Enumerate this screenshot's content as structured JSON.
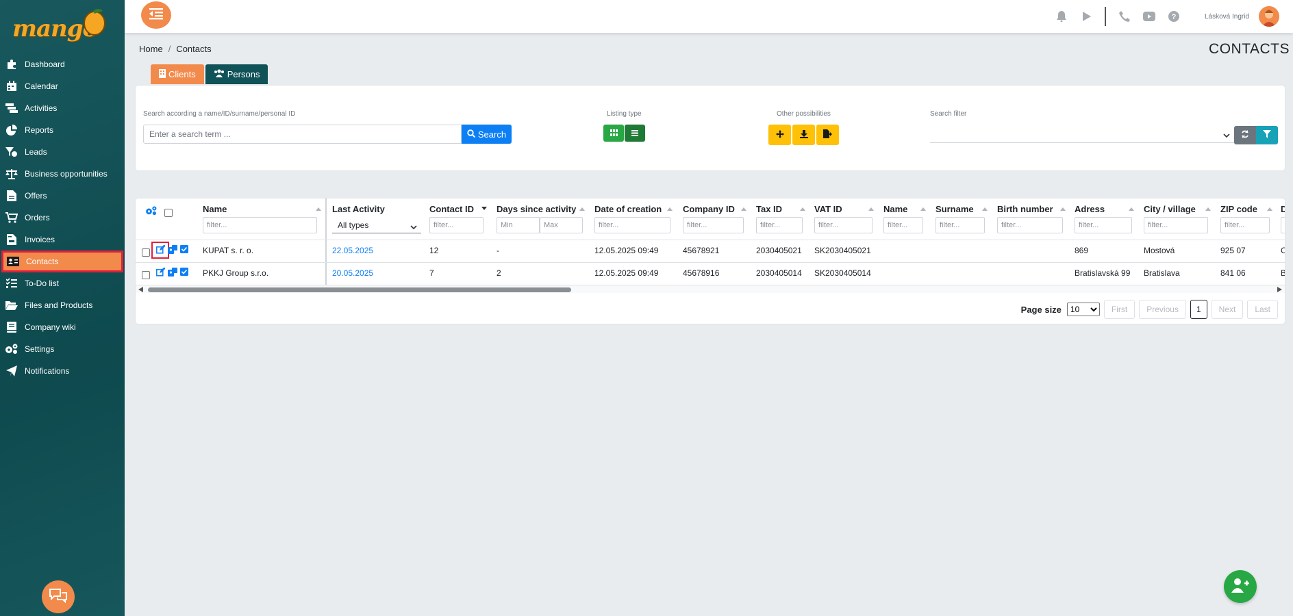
{
  "app": {
    "logo_text": "mango"
  },
  "sidebar": {
    "items": [
      {
        "label": "Dashboard",
        "icon": "puzzle-icon"
      },
      {
        "label": "Calendar",
        "icon": "calendar-icon"
      },
      {
        "label": "Activities",
        "icon": "activities-icon"
      },
      {
        "label": "Reports",
        "icon": "pie-chart-icon"
      },
      {
        "label": "Leads",
        "icon": "funnel-dollar-icon"
      },
      {
        "label": "Business opportunities",
        "icon": "scale-icon"
      },
      {
        "label": "Offers",
        "icon": "document-icon"
      },
      {
        "label": "Orders",
        "icon": "cart-icon"
      },
      {
        "label": "Invoices",
        "icon": "invoice-icon"
      },
      {
        "label": "Contacts",
        "icon": "address-card-icon",
        "active": true
      },
      {
        "label": "To-Do list",
        "icon": "checklist-icon"
      },
      {
        "label": "Files and Products",
        "icon": "folder-open-icon"
      },
      {
        "label": "Company wiki",
        "icon": "book-icon"
      },
      {
        "label": "Settings",
        "icon": "gears-icon"
      },
      {
        "label": "Notifications",
        "icon": "paper-plane-icon"
      }
    ]
  },
  "topbar": {
    "user_name": "Lásková Ingrid"
  },
  "breadcrumb": {
    "home": "Home",
    "sep": "/",
    "current": "Contacts"
  },
  "page_title": "CONTACTS",
  "tabs": {
    "clients": "Clients",
    "persons": "Persons"
  },
  "search": {
    "label": "Search according a name/ID/surname/personal ID",
    "placeholder": "Enter a search term ...",
    "button": "Search",
    "listing_label": "Listing type",
    "other_label": "Other possibilities",
    "filter_label": "Search filter"
  },
  "table": {
    "columns": {
      "name": "Name",
      "last_activity": "Last Activity",
      "contact_id": "Contact ID",
      "days_since": "Days since activity",
      "date_creation": "Date of creation",
      "company_id": "Company ID",
      "tax_id": "Tax ID",
      "vat_id": "VAT ID",
      "name2": "Name",
      "surname": "Surname",
      "birth": "Birth number",
      "adress": "Adress",
      "city": "City / village",
      "zip": "ZIP code",
      "next": "D"
    },
    "filter_placeholder": "filter...",
    "activity_select": "All types",
    "min_placeholder": "Min",
    "max_placeholder": "Max",
    "rows": [
      {
        "name": "KUPAT s. r. o.",
        "last_activity": "22.05.2025",
        "contact_id": "12",
        "days_since": "-",
        "date_creation": "12.05.2025 09:49",
        "company_id": "45678921",
        "tax_id": "2030405021",
        "vat_id": "SK2030405021",
        "adress": "869",
        "city": "Mostová",
        "zip": "925 07",
        "next": "C"
      },
      {
        "name": "PKKJ Group s.r.o.",
        "last_activity": "20.05.2025",
        "contact_id": "7",
        "days_since": "2",
        "date_creation": "12.05.2025 09:49",
        "company_id": "45678916",
        "tax_id": "2030405014",
        "vat_id": "SK2030405014",
        "adress": "Bratislavská 99",
        "city": "Bratislava",
        "zip": "841 06",
        "next": "B"
      }
    ]
  },
  "pager": {
    "label": "Page size",
    "size": "10",
    "first": "First",
    "previous": "Previous",
    "current": "1",
    "next": "Next",
    "last": "Last"
  },
  "colors": {
    "sidebar": "#0f5257",
    "accent": "#f28a4b",
    "primary": "#0d7ff5",
    "success": "#28a745",
    "warning": "#ffc107",
    "highlight": "#e0203c"
  }
}
